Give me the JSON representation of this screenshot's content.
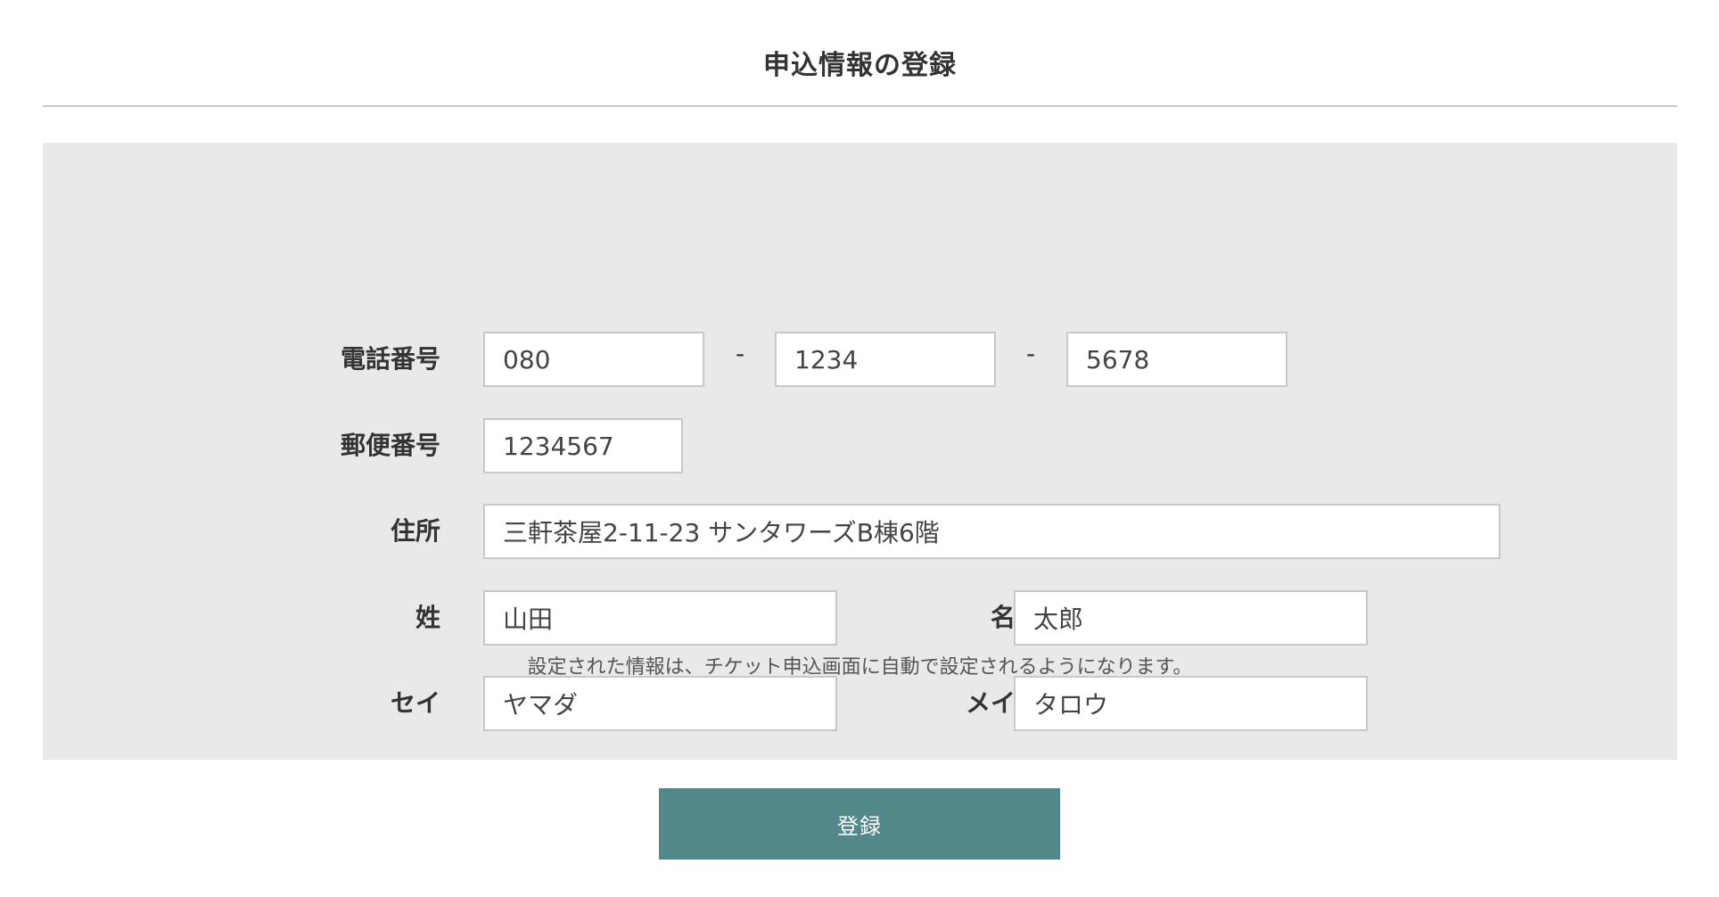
{
  "page": {
    "title": "申込情報の登録"
  },
  "form": {
    "phone": {
      "label": "電話番号",
      "part1": "080",
      "part2": "1234",
      "part3": "5678",
      "separator": "-"
    },
    "postal_code": {
      "label": "郵便番号",
      "value": "1234567"
    },
    "address": {
      "label": "住所",
      "value": "三軒茶屋2-11-23 サンタワーズB棟6階"
    },
    "last_name": {
      "label": "姓",
      "value": "山田"
    },
    "first_name": {
      "label": "名",
      "value": "太郎"
    },
    "last_name_kana": {
      "label": "セイ",
      "value": "ヤマダ"
    },
    "first_name_kana": {
      "label": "メイ",
      "value": "タロウ"
    },
    "note": "設定された情報は、チケット申込画面に自動で設定されるようになります。"
  },
  "actions": {
    "submit_label": "登録"
  },
  "colors": {
    "panel_background": "#e8e9e9",
    "button_background": "#52888a",
    "button_text": "#ffffff"
  }
}
